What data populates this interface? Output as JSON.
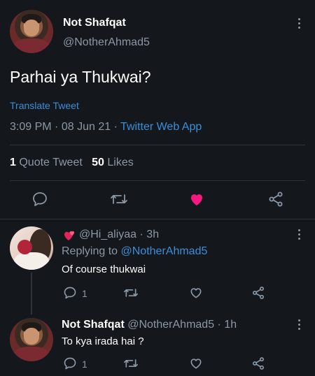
{
  "main_tweet": {
    "display_name": "Not Shafqat",
    "handle": "@NotherAhmad5",
    "text": "Parhai ya Thukwai?",
    "translate_label": "Translate Tweet",
    "time": "3:09 PM",
    "date": "08 Jun 21",
    "app": "Twitter Web App",
    "quote_count": "1",
    "quote_label": "Quote Tweet",
    "likes_count": "50",
    "likes_label": "Likes"
  },
  "reply1": {
    "handle": "@Hi_aliyaa",
    "age": "3h",
    "replying_prefix": "Replying to",
    "replying_to": "@NotherAhmad5",
    "text": "Of course thukwai",
    "reply_count": "1"
  },
  "reply2": {
    "display_name": "Not Shafqat",
    "handle": "@NotherAhmad5",
    "age": "1h",
    "text": "To kya irada hai ?",
    "reply_count": "1"
  },
  "colors": {
    "background": "#14171c",
    "accent": "#3a8fd9",
    "like": "#f91880",
    "muted": "#8b98a5"
  },
  "separator": "·"
}
